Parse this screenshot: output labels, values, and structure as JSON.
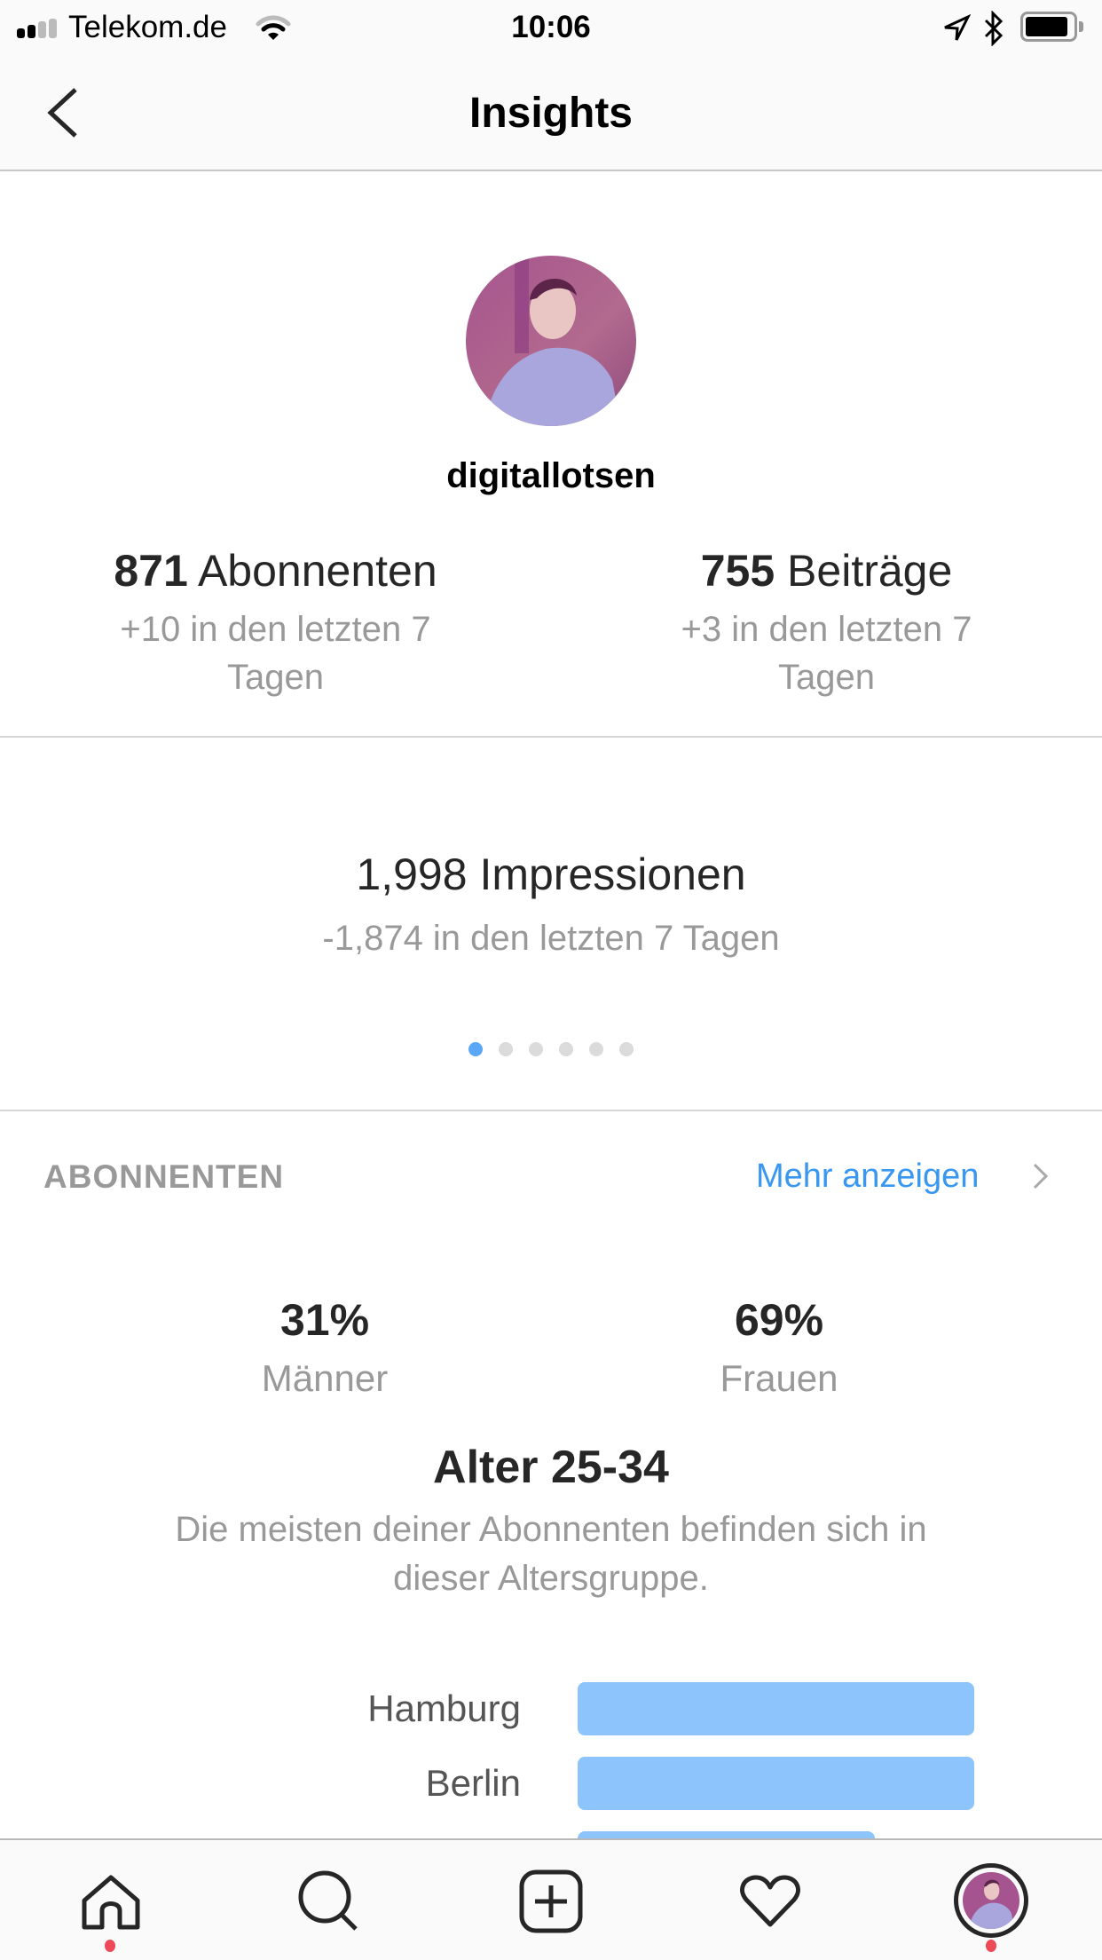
{
  "status_bar": {
    "carrier": "Telekom.de",
    "time": "10:06",
    "signal_bars_active": 2,
    "signal_bars_total": 4,
    "battery_level": 0.9,
    "icons": [
      "signal-icon",
      "wifi-icon",
      "location-icon",
      "bluetooth-icon",
      "battery-icon"
    ]
  },
  "header": {
    "title": "Insights",
    "back_icon": "chevron-left-icon"
  },
  "profile": {
    "username": "digitallotsen"
  },
  "stats": [
    {
      "value": "871",
      "label": "Abonnenten",
      "change": "+10 in den letzten 7 Tagen"
    },
    {
      "value": "755",
      "label": "Beiträge",
      "change": "+3 in den letzten 7 Tagen"
    }
  ],
  "carousel": {
    "value": "1,998",
    "label": "Impressionen",
    "change": "-1,874 in den letzten 7 Tagen",
    "page_count": 6,
    "active_page": 0
  },
  "followers_section": {
    "title": "ABONNENTEN",
    "more_label": "Mehr anzeigen",
    "gender": [
      {
        "value": "31%",
        "label": "Männer"
      },
      {
        "value": "69%",
        "label": "Frauen"
      }
    ],
    "age_title": "Alter 25-34",
    "age_description": "Die meisten deiner Abonnenten befinden sich in dieser Altersgruppe.",
    "cities": [
      {
        "name": "Hamburg",
        "relative_value": 1.0
      },
      {
        "name": "Berlin",
        "relative_value": 1.0
      },
      {
        "name": "",
        "relative_value": 0.75
      }
    ]
  },
  "tab_bar": {
    "tabs": [
      {
        "name": "home",
        "icon": "home-icon",
        "notification_dot": true
      },
      {
        "name": "search",
        "icon": "search-icon",
        "notification_dot": false
      },
      {
        "name": "new-post",
        "icon": "plus-square-icon",
        "notification_dot": false
      },
      {
        "name": "activity",
        "icon": "heart-icon",
        "notification_dot": false
      },
      {
        "name": "profile",
        "icon": "profile-avatar-icon",
        "notification_dot": true
      }
    ]
  },
  "colors": {
    "accent_blue": "#3897f0",
    "bar_blue": "#8dc4fc",
    "page_dot_active": "#5aa8f5",
    "notification_red": "#ed4956",
    "muted_text": "#999999"
  }
}
